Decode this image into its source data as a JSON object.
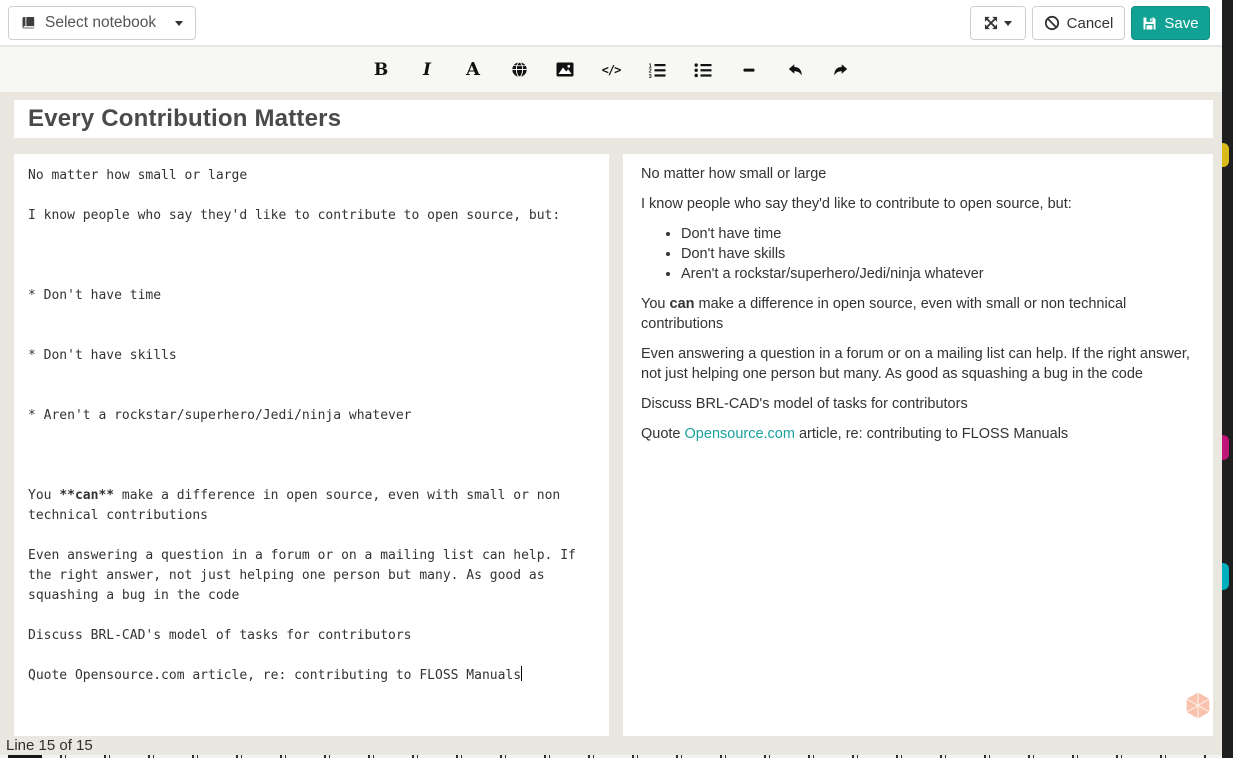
{
  "app": {
    "background": "#e9e7df",
    "accent": "#12a295",
    "link_color": "#18a39e",
    "edge_stripe_color": "#1f1f1f",
    "edge_mark_colors": [
      "#d8bb16",
      "#c01578",
      "#00aebd"
    ]
  },
  "header": {
    "notebook_selector": {
      "label": "Select notebook",
      "icon": "book-icon"
    },
    "view_toggle": {
      "icon": "expand-arrows-icon"
    },
    "cancel": {
      "label": "Cancel",
      "icon": "ban-icon"
    },
    "save": {
      "label": "Save",
      "icon": "floppy-disk-icon"
    }
  },
  "toolbar": {
    "icons": [
      {
        "name": "bold-icon",
        "glyph": "B"
      },
      {
        "name": "italic-icon",
        "glyph": "I"
      },
      {
        "name": "heading-icon",
        "glyph": "A"
      },
      {
        "name": "globe-icon",
        "glyph": ""
      },
      {
        "name": "image-icon",
        "glyph": ""
      },
      {
        "name": "code-icon",
        "glyph": "</>"
      },
      {
        "name": "ordered-list-icon",
        "glyph": ""
      },
      {
        "name": "unordered-list-icon",
        "glyph": ""
      },
      {
        "name": "horizontal-rule-icon",
        "glyph": ""
      },
      {
        "name": "undo-icon",
        "glyph": ""
      },
      {
        "name": "redo-icon",
        "glyph": ""
      }
    ]
  },
  "note": {
    "title": "Every Contribution Matters"
  },
  "editor": {
    "p1": "No matter how small or large",
    "p2": "I know people who say they'd like to contribute to open source, but:",
    "list": [
      "* Don't have time",
      "* Don't have skills",
      "* Aren't a rockstar/superhero/Jedi/ninja whatever"
    ],
    "p3_pre": "You ",
    "p3_bold": "**can**",
    "p3_post": " make a difference in open source, even with small or non technical contributions",
    "p4": "Even answering a question in a forum or on a mailing list can help. If the right answer, not just helping one person but many. As good as squashing a bug in the code",
    "p5": "Discuss BRL-CAD's model of tasks for contributors",
    "p6": "Quote Opensource.com article, re: contributing to FLOSS Manuals"
  },
  "preview": {
    "p1": "No matter how small or large",
    "p2": "I know people who say they'd like to contribute to open source, but:",
    "bullets": [
      "Don't have time",
      "Don't have skills",
      "Aren't a rockstar/superhero/Jedi/ninja whatever"
    ],
    "p3_pre": "You ",
    "p3_bold": "can",
    "p3_post": " make a difference in open source, even with small or non technical contributions",
    "p4": "Even answering a question in a forum or on a mailing list can help. If the right answer, not just helping one person but many. As good as squashing a bug in the code",
    "p5": "Discuss BRL-CAD's model of tasks for contributors",
    "p6_pre": "Quote ",
    "p6_link": "Opensource.com",
    "p6_post": " article, re: contributing to FLOSS Manuals"
  },
  "footer": {
    "line_status": "Line 15 of 15"
  }
}
